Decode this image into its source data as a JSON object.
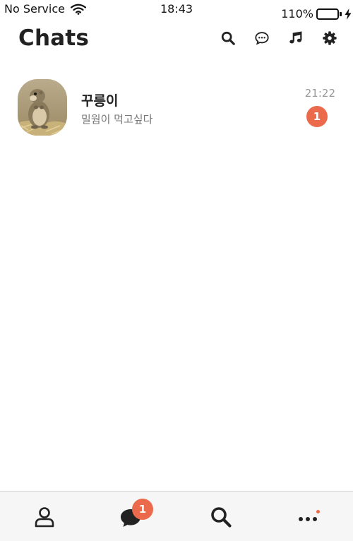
{
  "status_bar": {
    "carrier": "No Service",
    "time": "18:43",
    "battery": "110%"
  },
  "header": {
    "title": "Chats"
  },
  "chats": [
    {
      "name": "꾸릉이",
      "preview": "밀웜이 먹고싶다",
      "time": "21:22",
      "unread": "1"
    }
  ],
  "bottom_nav": {
    "chats_badge": "1"
  },
  "colors": {
    "badge": "#ea6a4b",
    "text_primary": "#222222",
    "text_secondary": "#777777",
    "nav_background": "#f6f6f6"
  },
  "icons": {
    "header": [
      "search-icon",
      "new-chat-icon",
      "music-icon",
      "settings-icon"
    ],
    "nav": [
      "friends-icon",
      "chats-icon",
      "search-icon",
      "more-icon"
    ]
  }
}
